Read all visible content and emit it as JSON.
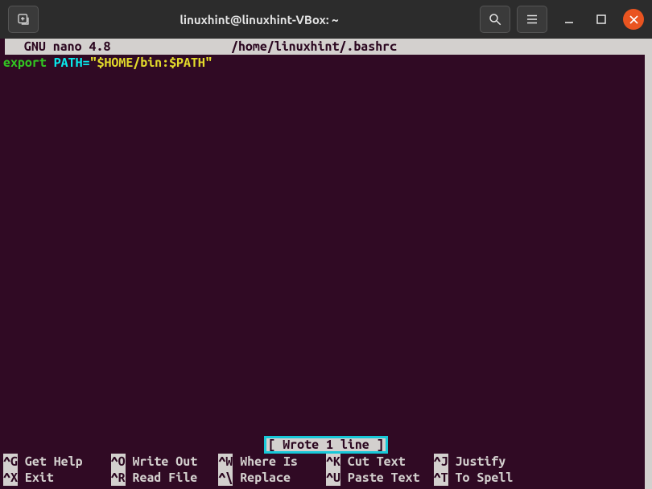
{
  "titlebar": {
    "title": "linuxhint@linuxhint-VBox: ~"
  },
  "nano": {
    "version_label": "  GNU nano 4.8",
    "filepath": "/home/linuxhint/.bashrc"
  },
  "editor": {
    "line1": {
      "keyword": "export",
      "var": " PATH=",
      "string": "\"$HOME/bin:$PATH\""
    }
  },
  "status": {
    "message": "[ Wrote 1 line ]"
  },
  "shortcuts": [
    {
      "key": "^G",
      "label": " Get Help"
    },
    {
      "key": "^O",
      "label": " Write Out"
    },
    {
      "key": "^W",
      "label": " Where Is"
    },
    {
      "key": "^K",
      "label": " Cut Text"
    },
    {
      "key": "^J",
      "label": " Justify"
    },
    {
      "key": "",
      "label": ""
    },
    {
      "key": "^X",
      "label": " Exit"
    },
    {
      "key": "^R",
      "label": " Read File"
    },
    {
      "key": "^\\",
      "label": " Replace"
    },
    {
      "key": "^U",
      "label": " Paste Text"
    },
    {
      "key": "^T",
      "label": " To Spell"
    },
    {
      "key": "",
      "label": ""
    }
  ]
}
